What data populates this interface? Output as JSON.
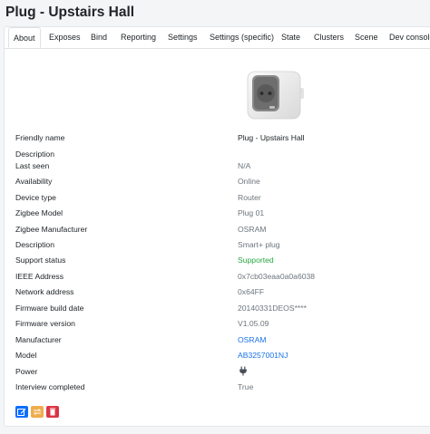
{
  "page": {
    "title": "Plug - Upstairs Hall"
  },
  "tabs": [
    {
      "label": "About"
    },
    {
      "label": "Exposes"
    },
    {
      "label": "Bind"
    },
    {
      "label": "Reporting"
    },
    {
      "label": "Settings"
    },
    {
      "label": "Settings (specific)"
    },
    {
      "label": "State"
    },
    {
      "label": "Clusters"
    },
    {
      "label": "Scene"
    },
    {
      "label": "Dev console"
    }
  ],
  "active_tab": "About",
  "device": {
    "rows": [
      {
        "label": "Friendly name",
        "value": "Plug - Upstairs Hall"
      },
      {
        "label": "Description",
        "value": ""
      },
      {
        "label": "Last seen",
        "value": "N/A"
      },
      {
        "label": "Availability",
        "value": "Online"
      },
      {
        "label": "Device type",
        "value": "Router"
      },
      {
        "label": "Zigbee Model",
        "value": "Plug 01"
      },
      {
        "label": "Zigbee Manufacturer",
        "value": "OSRAM"
      },
      {
        "label": "Description",
        "value": "Smart+ plug"
      },
      {
        "label": "Support status",
        "value": "Supported"
      },
      {
        "label": "IEEE Address",
        "value": "0x7cb03eaa0a0a6038"
      },
      {
        "label": "Network address",
        "value": "0x64FF"
      },
      {
        "label": "Firmware build date",
        "value": "20140331DEOS****"
      },
      {
        "label": "Firmware version",
        "value": "V1.05.09"
      },
      {
        "label": "Manufacturer",
        "value": "OSRAM"
      },
      {
        "label": "Model",
        "value": "AB3257001NJ"
      },
      {
        "label": "Power",
        "value": "",
        "icon": "plug-icon"
      },
      {
        "label": "Interview completed",
        "value": "True"
      }
    ]
  },
  "actions": [
    {
      "icon": "edit-icon",
      "color": "#0d6efd"
    },
    {
      "icon": "reconfigure-icon",
      "color": "#f0ad4e"
    },
    {
      "icon": "trash-icon",
      "color": "#dc3545"
    }
  ],
  "colors": {
    "supported": "#28a745",
    "link": "#1a73e8",
    "muted": "#6c757d"
  }
}
